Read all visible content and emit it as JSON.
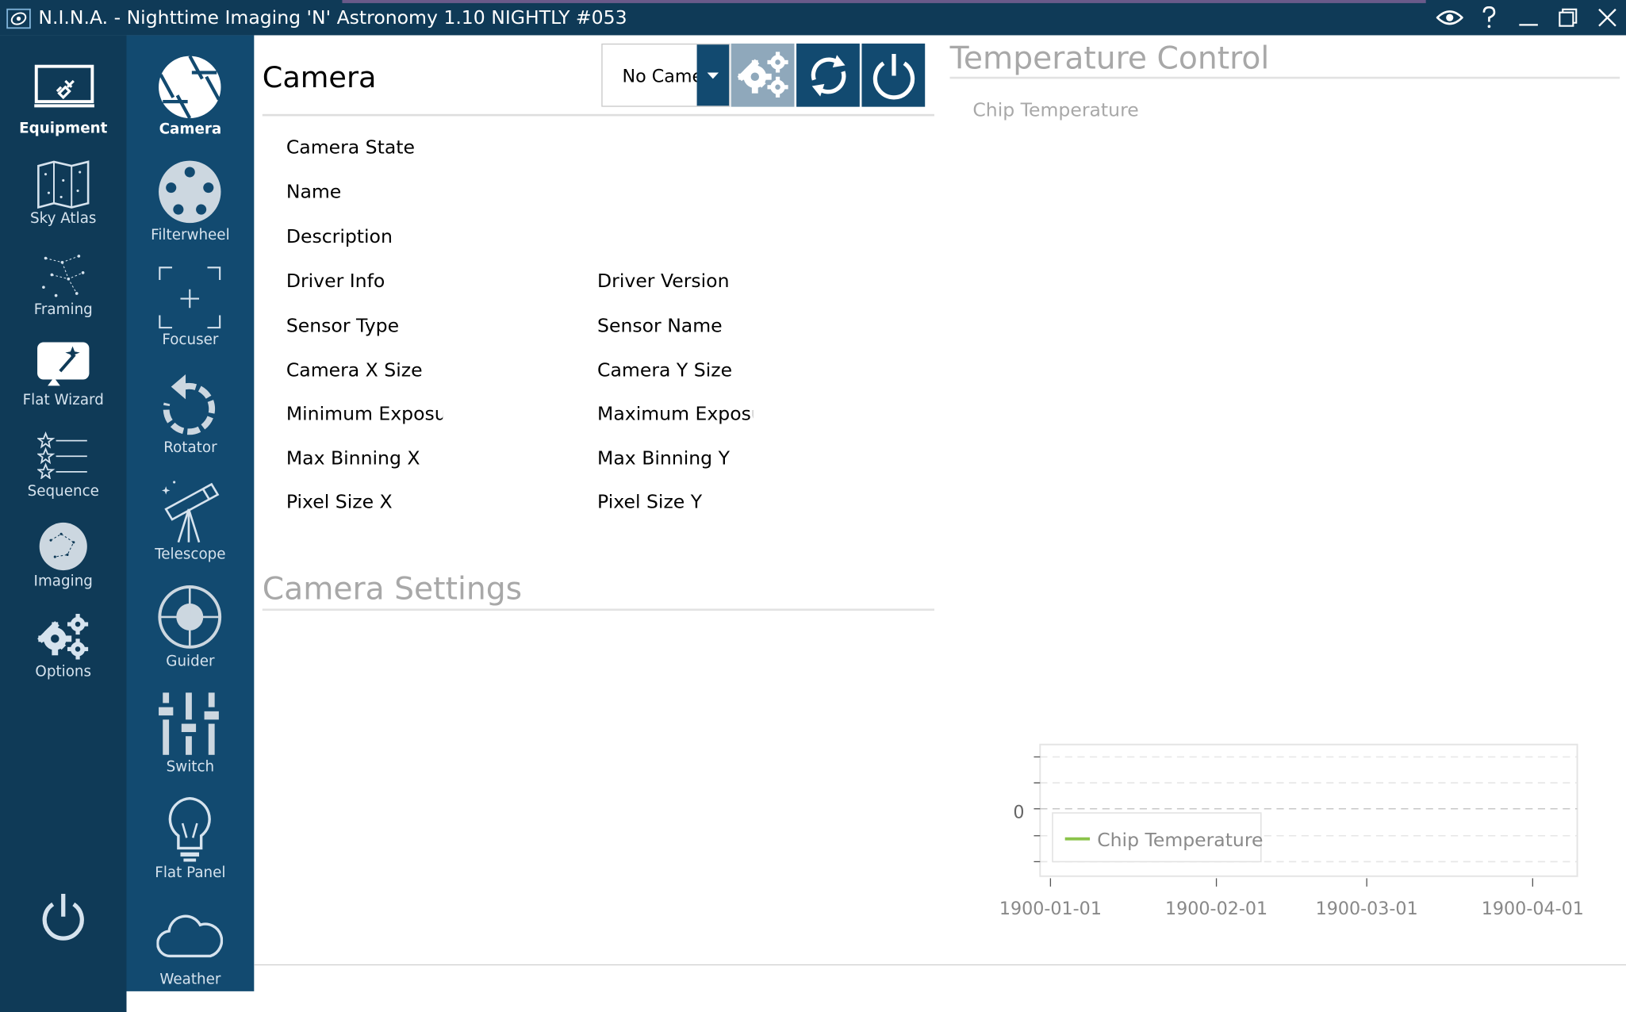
{
  "window": {
    "title": "N.I.N.A. - Nighttime Imaging 'N' Astronomy 1.10 NIGHTLY #053"
  },
  "nav_primary": [
    {
      "label": "Equipment",
      "icon": "laptop-plug-icon",
      "active": true
    },
    {
      "label": "Sky Atlas",
      "icon": "sky-map-icon"
    },
    {
      "label": "Framing",
      "icon": "constellation-icon"
    },
    {
      "label": "Flat Wizard",
      "icon": "flat-wizard-icon"
    },
    {
      "label": "Sequence",
      "icon": "sequence-stars-icon"
    },
    {
      "label": "Imaging",
      "icon": "imaging-globe-icon"
    },
    {
      "label": "Options",
      "icon": "gears-icon"
    }
  ],
  "nav_secondary": [
    {
      "label": "Camera",
      "icon": "camera-aperture-icon",
      "active": true
    },
    {
      "label": "Filterwheel",
      "icon": "filterwheel-icon"
    },
    {
      "label": "Focuser",
      "icon": "focuser-icon"
    },
    {
      "label": "Rotator",
      "icon": "rotator-icon"
    },
    {
      "label": "Telescope",
      "icon": "telescope-icon"
    },
    {
      "label": "Guider",
      "icon": "guider-crosshair-icon"
    },
    {
      "label": "Switch",
      "icon": "switch-sliders-icon"
    },
    {
      "label": "Flat Panel",
      "icon": "lightbulb-icon"
    },
    {
      "label": "Weather",
      "icon": "cloud-icon"
    }
  ],
  "camera": {
    "title": "Camera",
    "selected_device": "No Camera",
    "properties_left": [
      "Camera State",
      "Name",
      "Description",
      "Driver Info",
      "Sensor Type",
      "Camera X Size",
      "Minimum Exposure",
      "Max Binning X",
      "Pixel Size X"
    ],
    "properties_right": [
      "Driver Version",
      "Sensor Name",
      "Camera Y Size",
      "Maximum Exposure",
      "Max Binning Y",
      "Pixel Size Y"
    ],
    "settings_title": "Camera Settings"
  },
  "temperature": {
    "title": "Temperature Control",
    "chart_label": "Chip Temperature"
  },
  "chart_data": {
    "type": "line",
    "title": "Chip Temperature",
    "x_ticks": [
      "1900-01-01",
      "1900-02-01",
      "1900-03-01",
      "1900-04-01"
    ],
    "y_ticks": [
      "0"
    ],
    "series": [
      {
        "name": "Chip Temperature",
        "values": []
      }
    ],
    "legend_placement": "bottom-left",
    "series_color": "#8bc34a",
    "grid": true
  },
  "colors": {
    "nav_primary_bg": "#0f3a57",
    "nav_secondary_bg": "#124a70",
    "accent": "#124a70",
    "settings_button_bg": "#8fa8bb"
  }
}
